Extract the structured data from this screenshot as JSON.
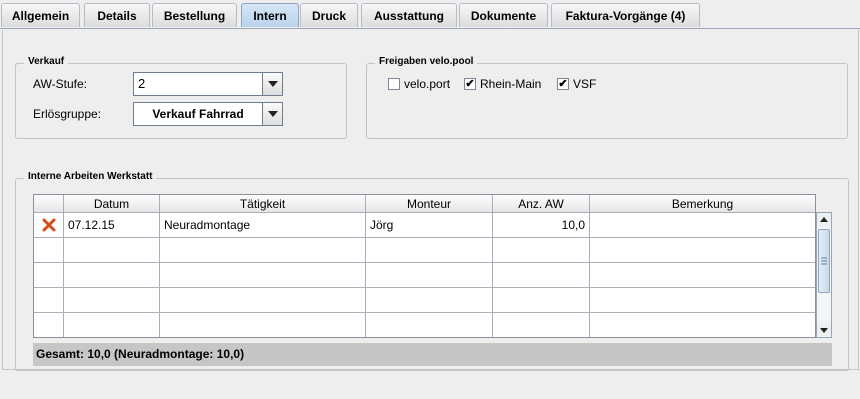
{
  "tabs": [
    {
      "label": "Allgemein"
    },
    {
      "label": "Details"
    },
    {
      "label": "Bestellung"
    },
    {
      "label": "Intern"
    },
    {
      "label": "Druck"
    },
    {
      "label": "Ausstattung"
    },
    {
      "label": "Dokumente"
    },
    {
      "label": "Faktura-Vorgänge (4)"
    }
  ],
  "active_tab": "Intern",
  "verkauf": {
    "title": "Verkauf",
    "aw_stufe_label": "AW-Stufe:",
    "aw_stufe_value": "2",
    "erloesgruppe_label": "Erlösgruppe:",
    "erloesgruppe_value": "Verkauf Fahrrad"
  },
  "freigaben": {
    "title": "Freigaben velo.pool",
    "checkboxes": [
      {
        "label": "velo.port",
        "checked": false
      },
      {
        "label": "Rhein-Main",
        "checked": true
      },
      {
        "label": "VSF",
        "checked": true
      }
    ]
  },
  "werkstatt": {
    "title": "Interne Arbeiten Werkstatt",
    "columns": [
      "",
      "Datum",
      "Tätigkeit",
      "Monteur",
      "Anz. AW",
      "Bemerkung"
    ],
    "rows": [
      {
        "delete_icon": "delete-x-icon",
        "datum": "07.12.15",
        "taetigkeit": "Neuradmontage",
        "monteur": "Jörg",
        "anz_aw": "10,0",
        "bemerkung": ""
      },
      {
        "datum": "",
        "taetigkeit": "",
        "monteur": "",
        "anz_aw": "",
        "bemerkung": ""
      },
      {
        "datum": "",
        "taetigkeit": "",
        "monteur": "",
        "anz_aw": "",
        "bemerkung": ""
      },
      {
        "datum": "",
        "taetigkeit": "",
        "monteur": "",
        "anz_aw": "",
        "bemerkung": ""
      },
      {
        "datum": "",
        "taetigkeit": "",
        "monteur": "",
        "anz_aw": "",
        "bemerkung": ""
      }
    ],
    "summary": "Gesamt: 10,0 (Neuradmontage: 10,0)"
  },
  "colors": {
    "active_tab": "#b9d3ec",
    "delete_icon": "#d9491a",
    "footer": "#c6c6c6"
  }
}
